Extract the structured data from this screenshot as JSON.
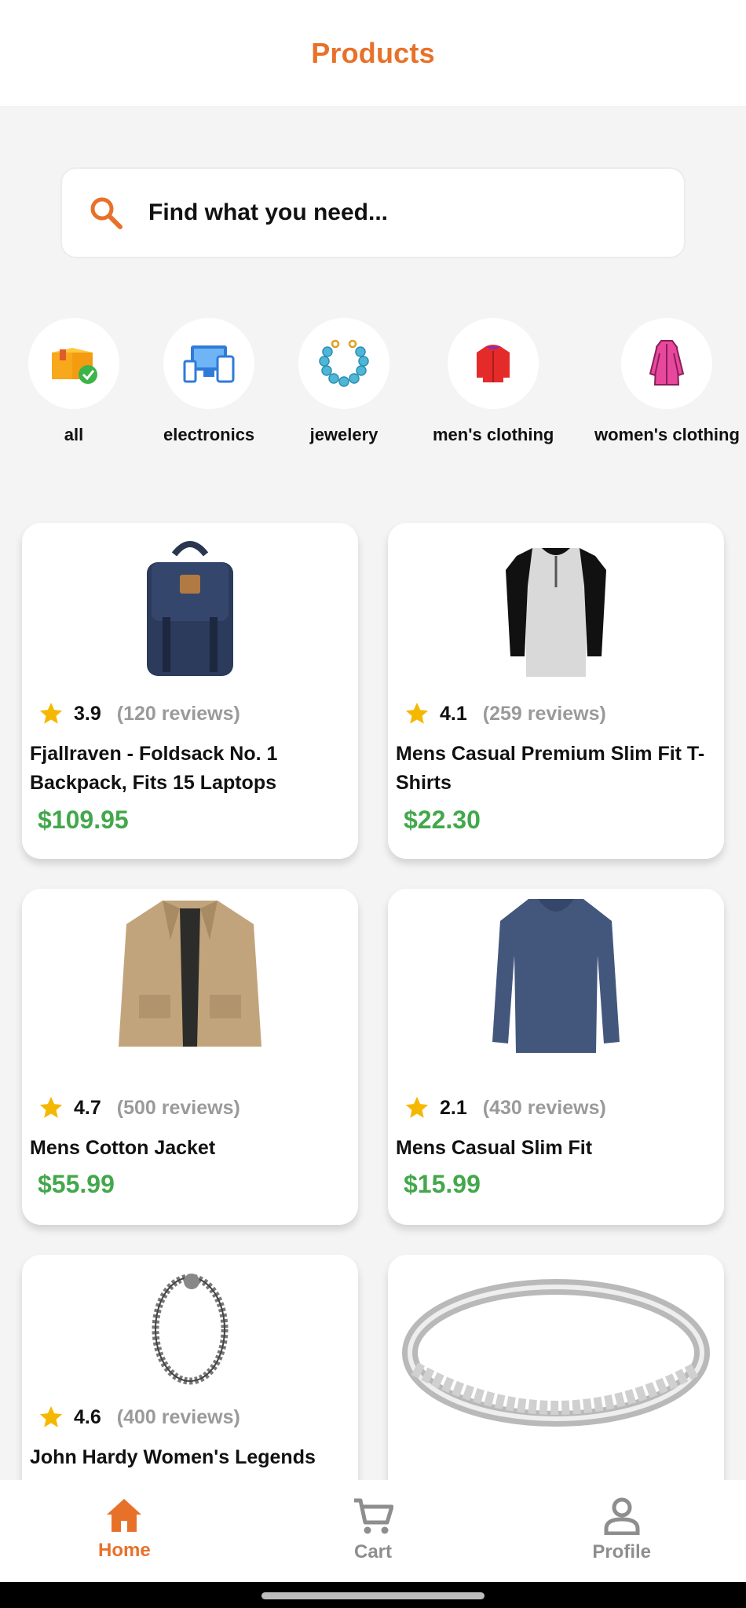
{
  "header": {
    "title": "Products"
  },
  "search": {
    "placeholder": "Find what you need..."
  },
  "categories": [
    {
      "label": "all",
      "icon": "box-check-icon"
    },
    {
      "label": "electronics",
      "icon": "devices-icon"
    },
    {
      "label": "jewelery",
      "icon": "bracelet-icon"
    },
    {
      "label": "men's clothing",
      "icon": "jacket-icon"
    },
    {
      "label": "women's clothing",
      "icon": "coat-icon"
    }
  ],
  "products": [
    {
      "rating": "3.9",
      "reviews": "(120 reviews)",
      "title": "Fjallraven - Foldsack No. 1 Backpack, Fits 15 Laptops",
      "price": "$109.95"
    },
    {
      "rating": "4.1",
      "reviews": "(259 reviews)",
      "title": "Mens Casual Premium Slim Fit T-Shirts",
      "price": "$22.30"
    },
    {
      "rating": "4.7",
      "reviews": "(500 reviews)",
      "title": "Mens Cotton Jacket",
      "price": "$55.99"
    },
    {
      "rating": "2.1",
      "reviews": "(430 reviews)",
      "title": "Mens Casual Slim Fit",
      "price": "$15.99"
    },
    {
      "rating": "4.6",
      "reviews": "(400 reviews)",
      "title": "John Hardy Women's Legends",
      "price": ""
    }
  ],
  "nav": [
    {
      "label": "Home",
      "icon": "home-icon",
      "active": true
    },
    {
      "label": "Cart",
      "icon": "cart-icon",
      "active": false
    },
    {
      "label": "Profile",
      "icon": "profile-icon",
      "active": false
    }
  ],
  "colors": {
    "accent": "#e8712a",
    "price": "#43a84b",
    "star": "#f5b800",
    "muted": "#9a9a9a"
  }
}
